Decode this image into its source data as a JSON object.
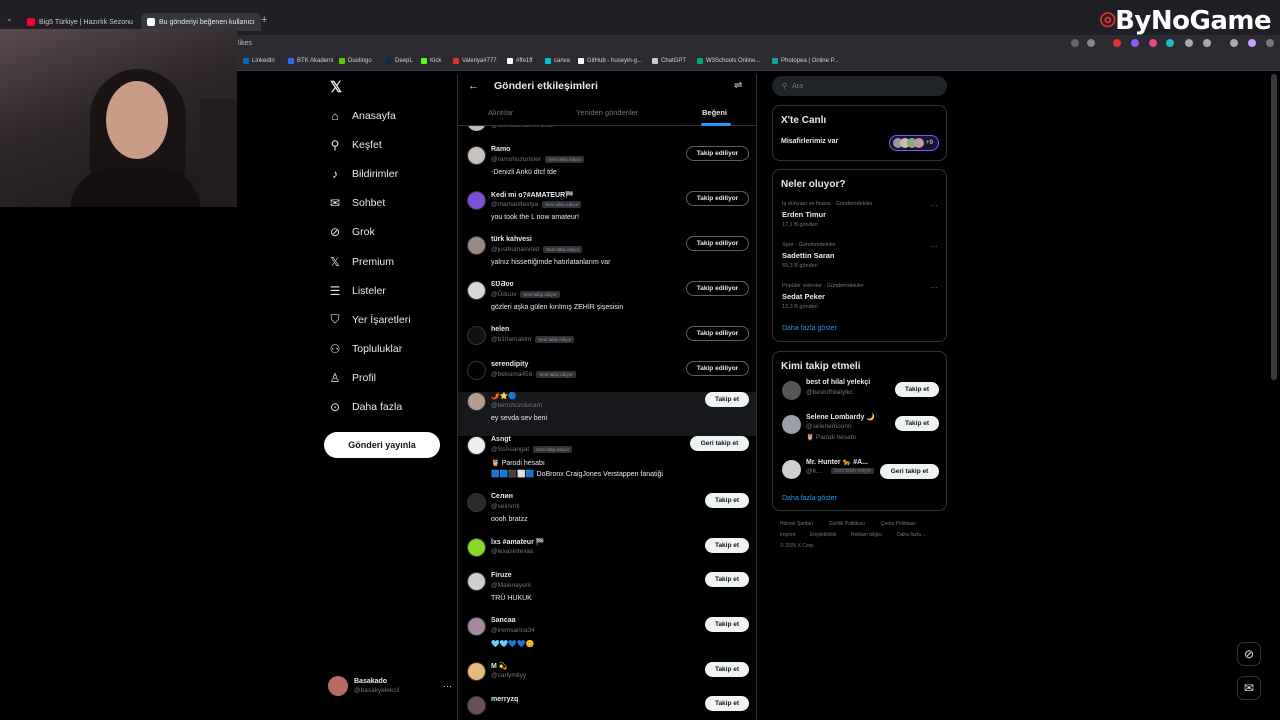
{
  "browser": {
    "tabs": [
      {
        "label": "Big5 Türkiye | Hazırlık Sezonu",
        "color": "#ff0033",
        "active": false
      },
      {
        "label": "Bu gönderiyi beğenen kullanıcı",
        "color": "#ffffff",
        "active": true
      }
    ],
    "address": "likes",
    "bookmarks": [
      {
        "label": "LinkedIn",
        "color": "#0a66c2"
      },
      {
        "label": "BTK Akademi",
        "color": "#2d6cdf"
      },
      {
        "label": "Duolingo",
        "color": "#58cc02"
      },
      {
        "label": "DeepL",
        "color": "#0f2b46"
      },
      {
        "label": "Kick",
        "color": "#53fc18"
      },
      {
        "label": "Valeriya#777",
        "color": "#e03131"
      },
      {
        "label": "#ffe1ff",
        "color": "#ffffff"
      },
      {
        "label": "canva",
        "color": "#00c4cc"
      },
      {
        "label": "GitHub - huseyin-g...",
        "color": "#ffffff"
      },
      {
        "label": "ChatGPT",
        "color": "#cccccc"
      },
      {
        "label": "W3Schools Online...",
        "color": "#04aa6d"
      },
      {
        "label": "Photopea | Online P...",
        "color": "#18a497"
      }
    ],
    "watermark": "ByNoGame"
  },
  "nav": {
    "items": [
      {
        "label": "Anasayfa",
        "icon": "home-icon",
        "glyph": "⌂"
      },
      {
        "label": "Keşfet",
        "icon": "search-icon",
        "glyph": "⚲"
      },
      {
        "label": "Bildirimler",
        "icon": "bell-icon",
        "glyph": "♪"
      },
      {
        "label": "Sohbet",
        "icon": "mail-icon",
        "glyph": "✉"
      },
      {
        "label": "Grok",
        "icon": "grok-icon",
        "glyph": "⊘"
      },
      {
        "label": "Premium",
        "icon": "x-logo-icon",
        "glyph": "𝕏"
      },
      {
        "label": "Listeler",
        "icon": "list-icon",
        "glyph": "☰"
      },
      {
        "label": "Yer İşaretleri",
        "icon": "bookmark-icon",
        "glyph": "⛉"
      },
      {
        "label": "Topluluklar",
        "icon": "people-icon",
        "glyph": "⚇"
      },
      {
        "label": "Profil",
        "icon": "person-icon",
        "glyph": "♙"
      },
      {
        "label": "Daha fazla",
        "icon": "more-circle-icon",
        "glyph": "⊙"
      }
    ],
    "post_button": "Gönderi yayınla",
    "account_name": "Basakado",
    "account_handle": "@basakyelekcil"
  },
  "main": {
    "title": "Gönderi etkileşimleri",
    "tabs": [
      "Alıntılar",
      "Yeniden gönderiler",
      "Beğeni"
    ],
    "active_tab": "Beğeni",
    "users": [
      {
        "name": "Ramo",
        "handle": "@ramohuzurister",
        "badge": "Seni takip ediyor",
        "bio": "-Denizli Ankü dtcf tde",
        "button": "Takip ediliyor",
        "kind": "following",
        "color": "#c8c2bd"
      },
      {
        "name": "Kedi mi o?#AMATEUR🏁",
        "handle": "@mamanifestya",
        "badge": "Seni takip ediyor",
        "bio": "you took the L now amateur!",
        "button": "Takip ediliyor",
        "kind": "following",
        "color": "#7b4fd6"
      },
      {
        "name": "türk kahvesi",
        "handle": "@justbumasvoid",
        "badge": "Seni takip ediyor",
        "bio": "yalnız hissettiğimde hatırlatanlarım var",
        "button": "Takip ediliyor",
        "kind": "following",
        "color": "#9a8a84"
      },
      {
        "name": "ƐƲƋʋʋ",
        "handle": "@Ũduuv",
        "badge": "Seni takip ediyor",
        "bio": "gözleri aşka gülen kırılmış ZEHİR şişesisin",
        "button": "Takip ediliyor",
        "kind": "following",
        "color": "#d8d8d8"
      },
      {
        "name": "helen",
        "handle": "@b1rlamaklm",
        "badge": "Seni takip ediyor",
        "bio": "",
        "button": "Takip ediliyor",
        "kind": "following",
        "color": "#111111"
      },
      {
        "name": "serendipity",
        "handle": "@belisima456",
        "badge": "Seni takip ediyor",
        "bio": "",
        "button": "Takip ediliyor",
        "kind": "following",
        "color": "#000000"
      },
      {
        "name": "🌶️⭐🔵",
        "handle": "@temizkizolucam",
        "badge": "",
        "bio": "ey sevda sev beni",
        "button": "Takip et",
        "kind": "follow",
        "color": "#b59c8e"
      },
      {
        "name": "Asngt",
        "handle": "@SsAsangat",
        "badge": "Seni takip ediyor",
        "bio": "🦉 Parodi hesabı",
        "bio2": "🟦🟦⬛⬜🟦 DoBronx CraigJones Verstappen fanatiği",
        "button": "Geri takip et",
        "kind": "followback",
        "color": "#eeeeee"
      },
      {
        "name": "Селин",
        "handle": "@selinmtl",
        "badge": "",
        "bio": "oooh bratzz",
        "button": "Takip et",
        "kind": "follow",
        "color": "#2a2a2a"
      },
      {
        "name": "lxs #amateur 🏁",
        "handle": "@lexasintexas",
        "badge": "",
        "bio": "",
        "button": "Takip et",
        "kind": "follow",
        "color": "#8ad62a"
      },
      {
        "name": "Firuze",
        "handle": "@Malenayeril",
        "badge": "",
        "bio": "TRÜ HUKUK",
        "button": "Takip et",
        "kind": "follow",
        "color": "#cfcfcf"
      },
      {
        "name": "Sancaa",
        "handle": "@iremsarica34",
        "badge": "",
        "bio": "🩵🩵💙💙😊",
        "button": "Takip et",
        "kind": "follow",
        "color": "#a889a0"
      },
      {
        "name": "M 💫",
        "handle": "@carlymilyy",
        "badge": "",
        "bio": "",
        "button": "Takip et",
        "kind": "follow",
        "color": "#e7b97a"
      },
      {
        "name": "merryzq",
        "handle": "",
        "badge": "",
        "bio": "",
        "button": "Takip et",
        "kind": "follow",
        "color": "#6a4f5a"
      }
    ],
    "partial_top_handle": "@MerveENERYA0097"
  },
  "right": {
    "search_placeholder": "Ara",
    "live": {
      "title": "X'te Canlı",
      "text": "Misafirlerimiz var",
      "plus": "+9"
    },
    "trends_title": "Neler oluyor?",
    "trends": [
      {
        "meta": "İş dünyası ve finans · Gündemdekiler",
        "name": "Erden Timur",
        "count": "17,1 B gönderi"
      },
      {
        "meta": "Spor · Gündemdekiler",
        "name": "Sadettin Saran",
        "count": "59,3 B gönderi"
      },
      {
        "meta": "Popüler videolar · Gündemdekiler",
        "name": "Sedat Peker",
        "count": "13,3 B gönderi"
      }
    ],
    "trends_more": "Daha fazla göster",
    "wtf_title": "Kimi takip etmeli",
    "wtf": [
      {
        "name": "best of hilal yelekçi",
        "handle": "@bestofhilalylkc",
        "sub": "",
        "button": "Takip et",
        "kind": "follow",
        "color": "#555555"
      },
      {
        "name": "Selene Lombardy 🌙",
        "handle": "@selenemoonn",
        "sub": "🦉 Parodi hesabı",
        "button": "Takip et",
        "kind": "follow",
        "color": "#9aa0a8"
      },
      {
        "name": "Mr. Hunter 🐆 #A...",
        "handle": "@K...",
        "sub": "Seni takip ediyor",
        "button": "Geri takip et",
        "kind": "followback",
        "color": "#d0d0d0"
      }
    ],
    "wtf_more": "Daha fazla göster",
    "footer": [
      "Hizmet Şartları",
      "Gizlilik Politikası",
      "Çerez Politikası",
      "Imprint",
      "Erişilebilirlik",
      "Reklam bilgisi",
      "Daha fazla ...",
      "© 2025 X Corp."
    ]
  }
}
